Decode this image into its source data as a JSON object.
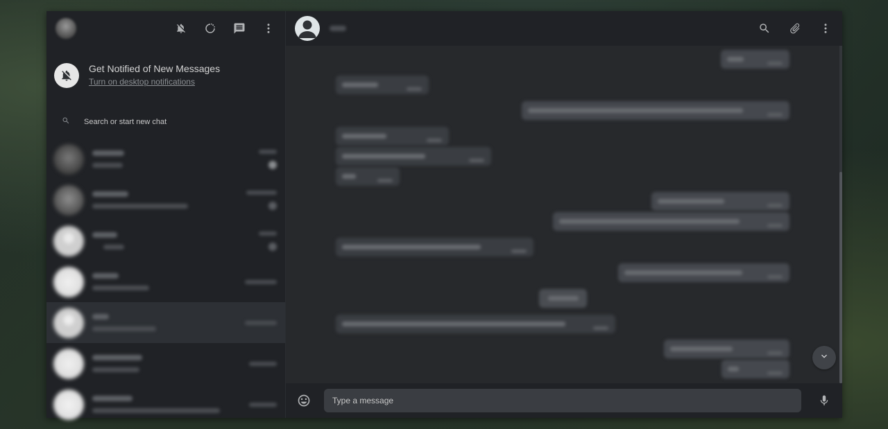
{
  "notification": {
    "title": "Get Notified of New Messages",
    "link": "Turn on desktop notifications"
  },
  "search": {
    "placeholder": "Search or start new chat"
  },
  "header_icons": [
    "bell-off-icon",
    "status-icon",
    "new-chat-icon",
    "menu-icon"
  ],
  "conversation_icons": [
    "search-icon",
    "attach-icon",
    "menu-icon"
  ],
  "chats_count_visible": 7,
  "composer": {
    "placeholder": "Type a message"
  },
  "colors": {
    "panel": "#202226",
    "conversation_bg": "#27292c",
    "active_row": "#2d3035",
    "bubble_in": "#3a3d42",
    "bubble_out": "#45484e"
  }
}
